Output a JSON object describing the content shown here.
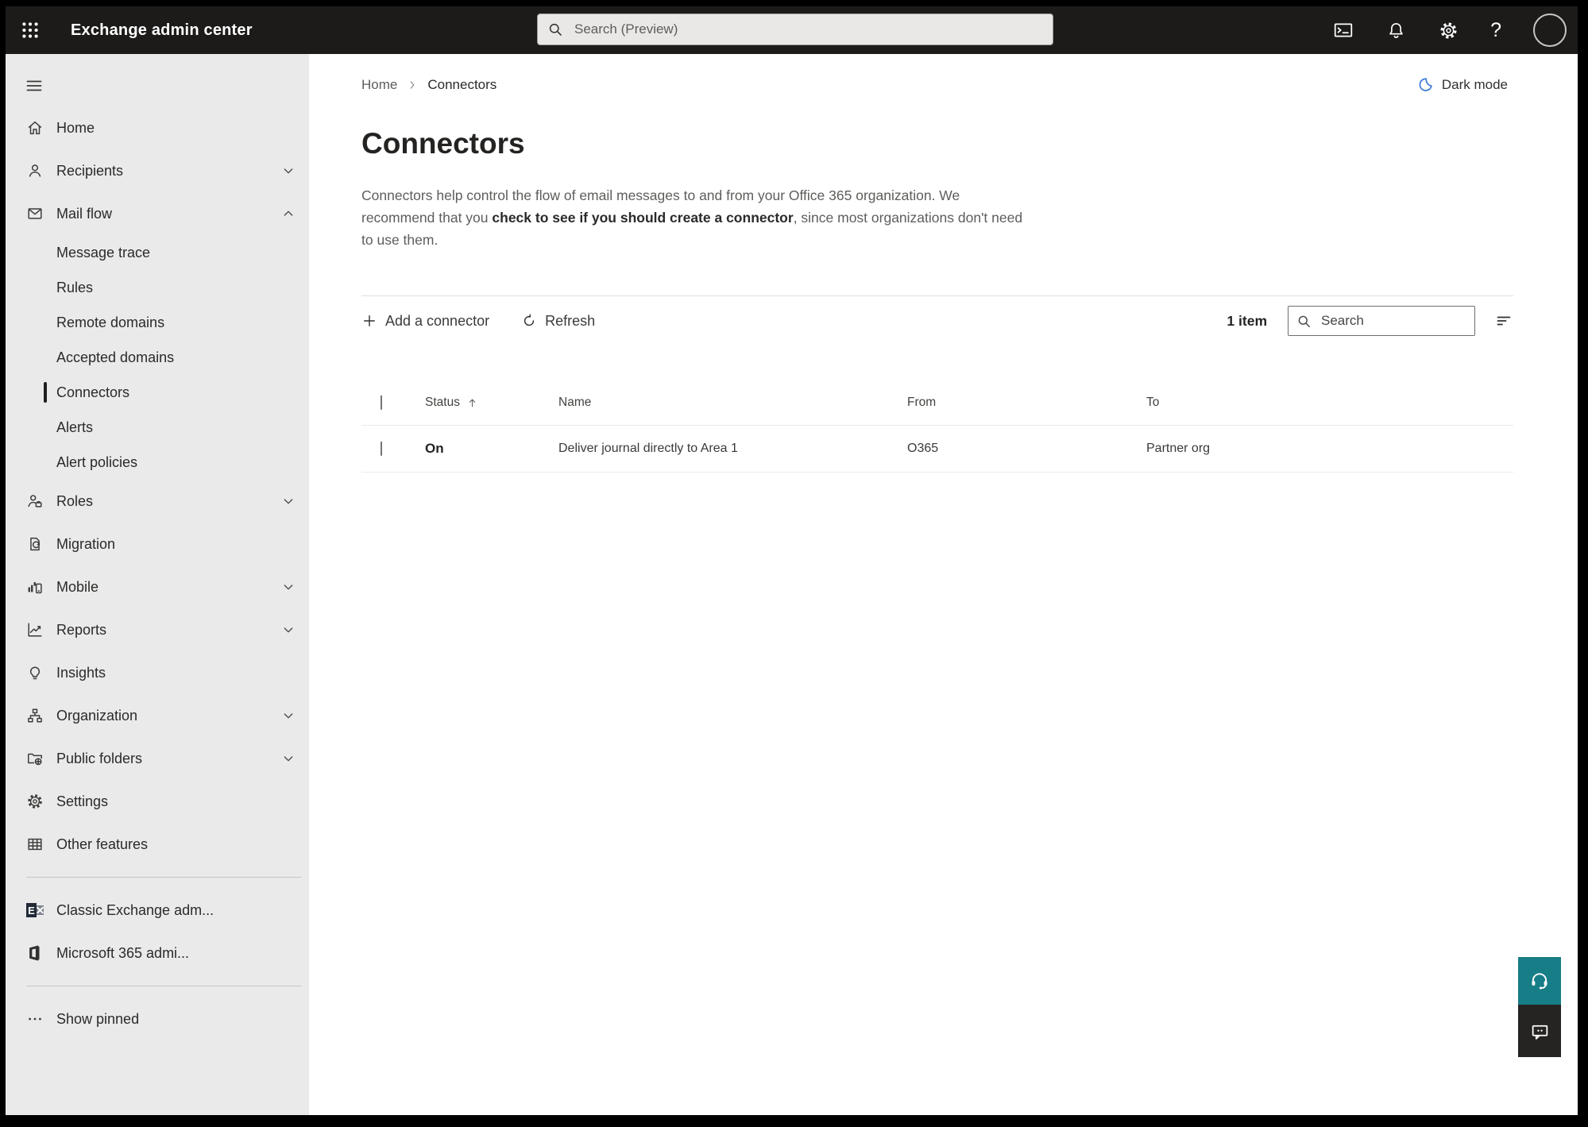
{
  "colors": {
    "topbar_bg": "#1c1b1a",
    "sidebar_bg": "#eaeaea",
    "selected_indicator": "#201f1e",
    "dark_mode_moon": "#3b7dd8",
    "help_button_teal": "#177d87",
    "feedback_button_dark": "#252423"
  },
  "topbar": {
    "app_title": "Exchange admin center",
    "search_placeholder": "Search (Preview)",
    "help_glyph": "?",
    "icons": [
      "app-launcher-icon",
      "cloud-shell-icon",
      "bell-icon",
      "gear-icon",
      "help-icon",
      "avatar"
    ]
  },
  "sidebar": {
    "items": [
      {
        "label": "Home",
        "icon": "home-icon"
      },
      {
        "label": "Recipients",
        "icon": "person-icon",
        "expandable": true
      },
      {
        "label": "Mail flow",
        "icon": "mail-icon",
        "expandable": true,
        "expanded": true
      },
      {
        "label": "Message trace",
        "sub": true
      },
      {
        "label": "Rules",
        "sub": true
      },
      {
        "label": "Remote domains",
        "sub": true
      },
      {
        "label": "Accepted domains",
        "sub": true
      },
      {
        "label": "Connectors",
        "sub": true,
        "selected": true
      },
      {
        "label": "Alerts",
        "sub": true
      },
      {
        "label": "Alert policies",
        "sub": true
      },
      {
        "label": "Roles",
        "icon": "person-settings-icon",
        "expandable": true
      },
      {
        "label": "Migration",
        "icon": "document-sync-icon"
      },
      {
        "label": "Mobile",
        "icon": "mobile-chart-icon",
        "expandable": true
      },
      {
        "label": "Reports",
        "icon": "line-chart-icon",
        "expandable": true
      },
      {
        "label": "Insights",
        "icon": "lightbulb-icon"
      },
      {
        "label": "Organization",
        "icon": "org-chart-icon",
        "expandable": true
      },
      {
        "label": "Public folders",
        "icon": "folder-globe-icon",
        "expandable": true
      },
      {
        "label": "Settings",
        "icon": "gear-icon"
      },
      {
        "label": "Other features",
        "icon": "table-grid-icon"
      },
      {
        "label": "Classic Exchange adm...",
        "icon": "exchange-logo"
      },
      {
        "label": "Microsoft 365 admi...",
        "icon": "microsoft-365-logo"
      },
      {
        "label": "Show pinned",
        "icon": "ellipsis-icon"
      }
    ]
  },
  "breadcrumb": {
    "items": [
      "Home",
      "Connectors"
    ]
  },
  "dark_mode": {
    "label": "Dark mode",
    "icon": "moon-icon"
  },
  "page": {
    "title": "Connectors",
    "description_before": "Connectors help control the flow of email messages to and from your Office 365 organization. We recommend that you ",
    "description_emphasis": "check to see if you should create a connector",
    "description_after": ", since most organizations don't need to use them."
  },
  "toolbar": {
    "add_label": "Add a connector",
    "refresh_label": "Refresh",
    "item_count": "1 item",
    "search_placeholder": "Search"
  },
  "table": {
    "columns": [
      "Status",
      "Name",
      "From",
      "To"
    ],
    "sort": {
      "column": "Status",
      "direction": "ascending"
    },
    "rows": [
      {
        "status": "On",
        "name": "Deliver journal directly to Area 1",
        "from": "O365",
        "to": "Partner org"
      }
    ]
  },
  "logos": {
    "exchange_letter": "E"
  }
}
